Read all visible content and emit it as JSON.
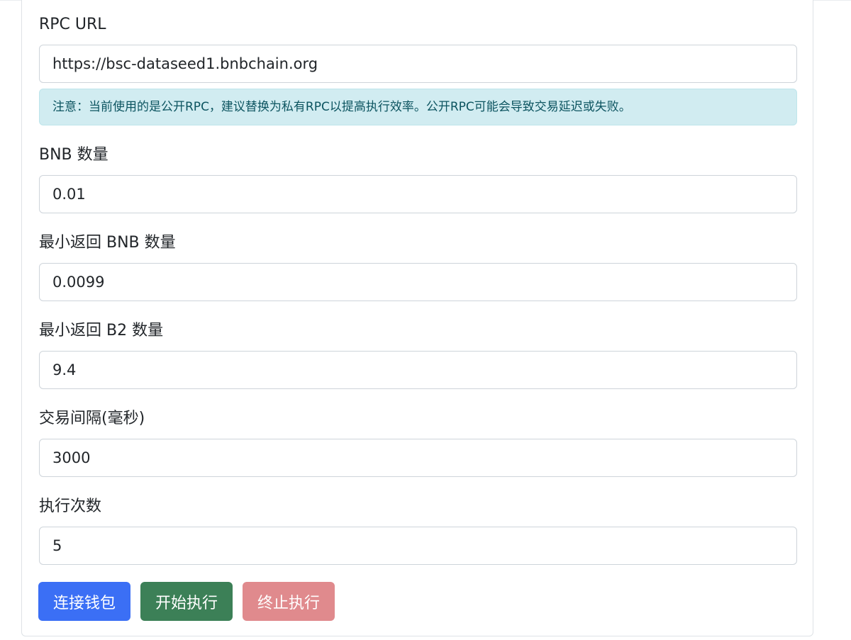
{
  "form": {
    "rpc_url": {
      "label": "RPC URL",
      "value": "https://bsc-dataseed1.bnbchain.org"
    },
    "rpc_notice": "注意：当前使用的是公开RPC，建议替换为私有RPC以提高执行效率。公开RPC可能会导致交易延迟或失败。",
    "bnb_amount": {
      "label": "BNB 数量",
      "value": "0.01"
    },
    "min_return_bnb": {
      "label": "最小返回 BNB 数量",
      "value": "0.0099"
    },
    "min_return_b2": {
      "label": "最小返回 B2 数量",
      "value": "9.4"
    },
    "trade_interval": {
      "label": "交易间隔(毫秒)",
      "value": "3000"
    },
    "execution_count": {
      "label": "执行次数",
      "value": "5"
    }
  },
  "buttons": {
    "connect_wallet": "连接钱包",
    "start": "开始执行",
    "stop": "终止执行"
  },
  "colors": {
    "primary": "#3b6ff5",
    "success": "#3c8057",
    "danger_disabled": "#e08a8d",
    "info_bg": "#d1ecf1",
    "info_text": "#0c5460"
  }
}
